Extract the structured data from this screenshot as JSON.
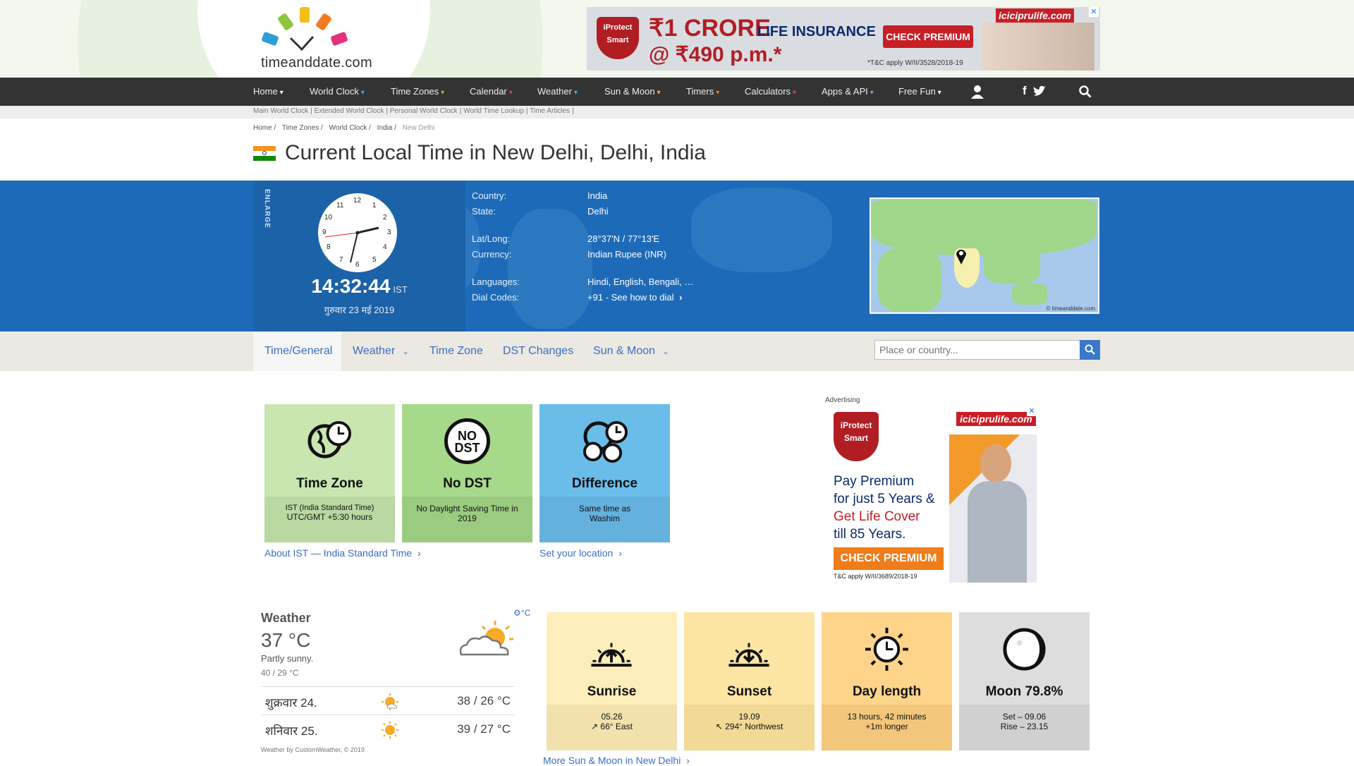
{
  "header": {
    "logo_text": "timeanddate.com",
    "ad": {
      "brand": "iciciprulife.com",
      "shield": "iProtect Smart",
      "headline_amount": "₹1 CRORE",
      "headline_text": "LIFE INSURANCE",
      "price": "@ ₹490 p.m.*",
      "button": "CHECK PREMIUM",
      "tc": "*T&C apply W/II/3528/2018-19"
    }
  },
  "nav": {
    "items": [
      "Home",
      "World Clock",
      "Time Zones",
      "Calendar",
      "Weather",
      "Sun & Moon",
      "Timers",
      "Calculators",
      "Apps & API",
      "Free Fun"
    ],
    "caret": "▾",
    "icons": [
      "user-icon",
      "facebook-icon",
      "twitter-icon",
      "search-icon"
    ],
    "sub_links": [
      "Main World Clock",
      "Extended World Clock",
      "Personal World Clock",
      "World Time Lookup",
      "Time Articles"
    ]
  },
  "breadcrumb": [
    "Home /",
    "Time Zones /",
    "World Clock /",
    "India /",
    "New Delhi"
  ],
  "page_title": "Current Local Time in New Delhi, Delhi, India",
  "clock": {
    "enlarge": "ENLARGE",
    "numbers": [
      "12",
      "1",
      "2",
      "3",
      "4",
      "5",
      "6",
      "7",
      "8",
      "9",
      "10",
      "11"
    ],
    "time": "14:32:44",
    "tz": "IST",
    "date": "गुरुवार 23 मई 2019"
  },
  "info": {
    "labels": [
      "Country:",
      "State:",
      "Lat/Long:",
      "Currency:",
      "Languages:",
      "Dial Codes:"
    ],
    "values": [
      "India",
      "Delhi",
      "28°37'N / 77°13'E",
      "Indian Rupee (INR)",
      "Hindi, English, Bengali, …",
      "+91 - See how to dial"
    ],
    "map_copyright": "© timeanddate.com"
  },
  "tabs": {
    "items": [
      "Time/General",
      "Weather",
      "Time Zone",
      "DST Changes",
      "Sun & Moon"
    ],
    "search_placeholder": "Place or country..."
  },
  "cards_top": [
    {
      "title": "Time Zone",
      "line1": "IST (India Standard Time)",
      "line2": "UTC/GMT +5:30 hours",
      "color": "#c9e6b1",
      "low": "#b9d8a2"
    },
    {
      "title": "No DST",
      "line1": "No Daylight Saving Time in 2019",
      "line2": "",
      "color": "#a7d98a",
      "low": "#9bcb80",
      "icon_text": "NO DST"
    },
    {
      "title": "Difference",
      "line1": "Same time as",
      "line2": "Washim",
      "color": "#6bbde9",
      "low": "#64b1dd"
    }
  ],
  "links": {
    "about_ist": "About IST — India Standard Time",
    "set_location": "Set your location",
    "more_sun": "More Sun & Moon in New Delhi"
  },
  "ad_side": {
    "label": "Advertising",
    "brand": "iciciprulife.com",
    "shield": "iProtect Smart",
    "line1": "Pay Premium",
    "line2": "for just 5 Years &",
    "line3": "Get Life Cover",
    "line4": "till 85 Years.",
    "button": "CHECK PREMIUM",
    "tc": "T&C apply W/II/3689/2018-19"
  },
  "weather": {
    "heading": "Weather",
    "unit": "°C",
    "temp": "37 °C",
    "desc": "Partly sunny.",
    "range": "40 / 29 °C",
    "forecast": [
      {
        "day": "शुक्रवार 24.",
        "temps": "38 / 26 °C"
      },
      {
        "day": "शनिवार 25.",
        "temps": "39 / 27 °C"
      }
    ],
    "credit": "Weather by CustomWeather, © 2019"
  },
  "sun_cards": [
    {
      "title": "Sunrise",
      "line1": "05.26",
      "line2": "↗ 66° East",
      "color": "#feeebb",
      "low": "#f2e1ad"
    },
    {
      "title": "Sunset",
      "line1": "19.09",
      "line2": "↖ 294° Northwest",
      "color": "#fde5a4",
      "low": "#f3d996"
    },
    {
      "title": "Day length",
      "line1": "13 hours, 42 minutes",
      "line2": "+1m longer",
      "color": "#fdd48a",
      "low": "#f2c77c"
    },
    {
      "title": "Moon 79.8%",
      "line1": "Set – 09.06",
      "line2": "Rise – 23.15",
      "color": "#dddddd",
      "low": "#d0d0d0"
    }
  ]
}
